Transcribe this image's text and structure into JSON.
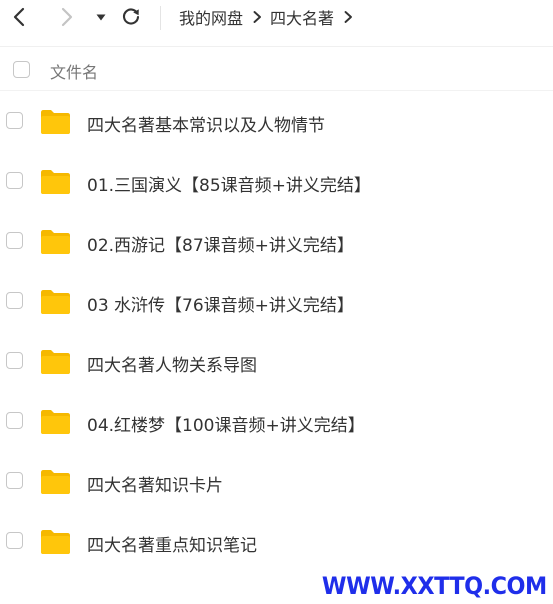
{
  "toolbar": {
    "back_icon": "chevron-left-icon",
    "forward_icon": "chevron-right-icon",
    "history_icon": "caret-down-icon",
    "refresh_icon": "refresh-icon"
  },
  "breadcrumb": {
    "items": [
      "我的网盘",
      "四大名著"
    ],
    "separator_icon": "chevron-right-icon"
  },
  "table": {
    "header": {
      "filename_label": "文件名"
    },
    "rows": [
      {
        "name": "四大名著基本常识以及人物情节",
        "icon": "folder-icon"
      },
      {
        "name": "01.三国演义【85课音频+讲义完结】",
        "icon": "folder-icon"
      },
      {
        "name": "02.西游记【87课音频+讲义完结】",
        "icon": "folder-icon"
      },
      {
        "name": "03 水浒传【76课音频+讲义完结】",
        "icon": "folder-icon"
      },
      {
        "name": "四大名著人物关系导图",
        "icon": "folder-icon"
      },
      {
        "name": "04.红楼梦【100课音频+讲义完结】",
        "icon": "folder-icon"
      },
      {
        "name": "四大名著知识卡片",
        "icon": "folder-icon"
      },
      {
        "name": "四大名著重点知识笔记",
        "icon": "folder-icon"
      }
    ]
  },
  "watermark": {
    "text": "WWW.XXTTQ.COM"
  },
  "colors": {
    "folder_back": "#f5b800",
    "folder_front": "#ffc60b",
    "watermark": "#1f2eea",
    "text": "#333333"
  }
}
